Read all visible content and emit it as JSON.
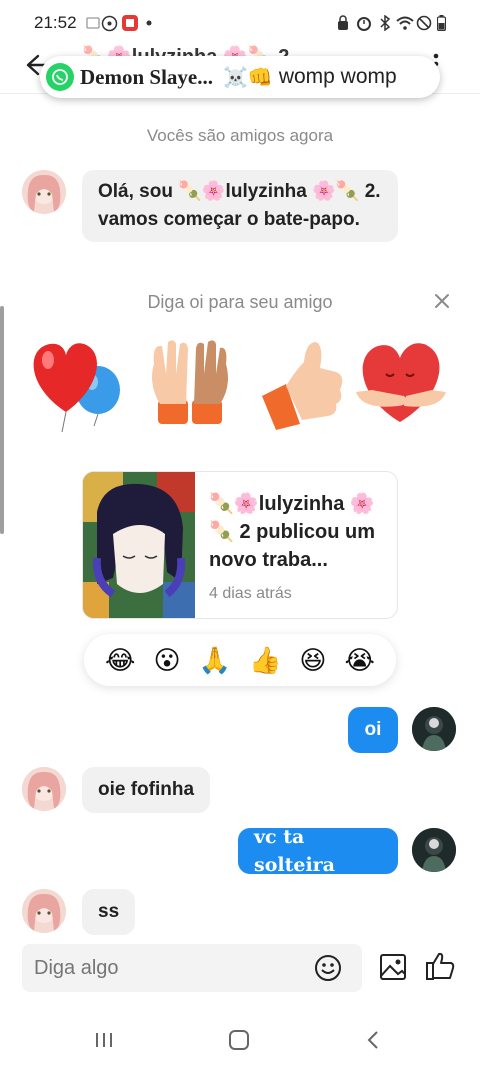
{
  "status_bar": {
    "time": "21:52"
  },
  "header": {
    "title": "🍡🌸lulyzinha 🌸🍡 2"
  },
  "notification": {
    "group": "Demon Slaye...",
    "emojis": "☠️👊",
    "message": "womp womp"
  },
  "chat": {
    "system_note": "Vocês são amigos agora",
    "intro_message": "Olá, sou 🍡🌸lulyzinha 🌸🍡 2. vamos começar o bate-papo.",
    "say_hi_title": "Diga oi para seu amigo",
    "stickers": [
      "red-heart-balloons",
      "high-five-hands",
      "thumbs-up",
      "heart-hug"
    ],
    "post_card": {
      "title": "🍡🌸lulyzinha 🌸🍡 2 publicou um novo traba...",
      "time": "4 dias atrás"
    },
    "reactions": [
      "😂",
      "😮",
      "🙏",
      "👍",
      "😆",
      "😭"
    ],
    "messages": [
      {
        "from": "me",
        "text": "oi"
      },
      {
        "from": "friend",
        "text": "oie fofinha"
      },
      {
        "from": "me",
        "text": "vc ta solteira"
      },
      {
        "from": "friend",
        "text": "ss"
      }
    ]
  },
  "composer": {
    "placeholder": "Diga algo"
  },
  "colors": {
    "accent": "#1d8cf0",
    "whatsapp": "#25d366",
    "bubble_in": "#f1f1f1"
  }
}
